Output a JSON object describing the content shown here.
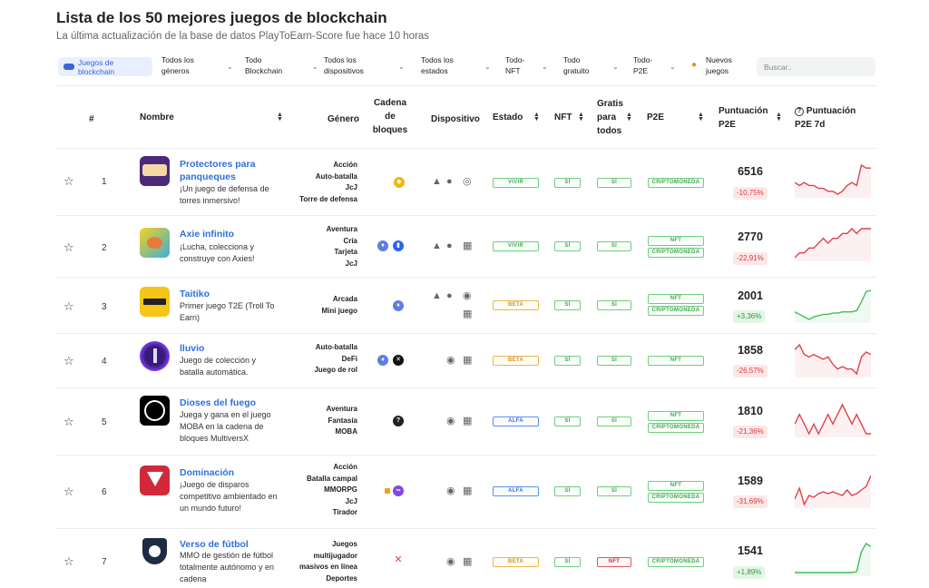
{
  "header": {
    "title": "Lista de los 50 mejores juegos de blockchain",
    "subtitle": "La última actualización de la base de datos PlayToEarn-Score fue hace 10 horas"
  },
  "filters": {
    "active_chip": [
      "Juegos de",
      "blockchain"
    ],
    "genres": [
      "Todos los",
      "géneros"
    ],
    "blockchain": [
      "Todo",
      "Blockchain"
    ],
    "devices": [
      "Todos los",
      "dispositivos"
    ],
    "states": [
      "Todos los",
      "estados"
    ],
    "nft": [
      "Todo-",
      "NFT"
    ],
    "free": [
      "Todo",
      "gratuito"
    ],
    "p2e": [
      "Todo-",
      "P2E"
    ],
    "new_games": [
      "Nuevos",
      "juegos"
    ],
    "search_placeholder": "Buscar.."
  },
  "columns": {
    "rank": "#",
    "name": "Nombre",
    "genre": "Género",
    "chain": [
      "Cadena",
      "de",
      "bloques"
    ],
    "device": "Dispositivo",
    "state": "Estado",
    "nft": "NFT",
    "free": [
      "Gratis",
      "para",
      "todos"
    ],
    "p2e": "P2E",
    "score": [
      "Puntuación",
      "P2E"
    ],
    "score7d": [
      "Puntuación",
      "P2E 7d"
    ]
  },
  "rows": [
    {
      "rank": "1",
      "name": "Protectores para panqueques",
      "desc": "¡Un juego de defensa de torres inmersivo!",
      "genres": [
        "Acción",
        "Auto-batalla",
        "JcJ",
        "Torre de defensa"
      ],
      "state": "VIVIR",
      "state_color": "green",
      "nft": "SÍ",
      "free": "SÍ",
      "p2e": [
        "CRIPTOMONEDA"
      ],
      "p2e_colors": [
        "green"
      ],
      "score": "6516",
      "change": "-10,75%",
      "trend": "down",
      "spark": [
        14,
        13,
        14,
        13,
        13,
        12,
        12,
        11,
        11,
        10,
        11,
        13,
        14,
        13,
        20,
        19,
        19
      ]
    },
    {
      "rank": "2",
      "name": "Axie infinito",
      "desc": "¡Lucha, colecciona y construye con Axies!",
      "genres": [
        "Aventura",
        "Cría",
        "Tarjeta",
        "JcJ"
      ],
      "state": "VIVIR",
      "state_color": "green",
      "nft": "SÍ",
      "free": "SÍ",
      "p2e": [
        "NFT",
        "CRIPTOMONEDA"
      ],
      "p2e_colors": [
        "green",
        "green"
      ],
      "score": "2770",
      "change": "-22,91%",
      "trend": "down",
      "spark": [
        14,
        15,
        15,
        16,
        16,
        17,
        18,
        17,
        18,
        18,
        19,
        19,
        20,
        19,
        20,
        20,
        20
      ]
    },
    {
      "rank": "3",
      "name": "Taitiko",
      "desc": "Primer juego T2E (Troll To Earn)",
      "genres": [
        "Arcada",
        "Mini juego"
      ],
      "state": "BETA",
      "state_color": "yellow",
      "nft": "SÍ",
      "free": "SÍ",
      "p2e": [
        "NFT",
        "CRIPTOMONEDA"
      ],
      "p2e_colors": [
        "green",
        "green"
      ],
      "score": "2001",
      "change": "+3,36%",
      "trend": "up",
      "spark": [
        12,
        10,
        8,
        6,
        8,
        9,
        10,
        10,
        11,
        11,
        12,
        12,
        12,
        13,
        20,
        28,
        29
      ]
    },
    {
      "rank": "4",
      "name": "lluvio",
      "desc": "Juego de colección y batalla automática.",
      "genres": [
        "Auto-batalla",
        "DeFi",
        "Juego de rol"
      ],
      "state": "BETA",
      "state_color": "yellow",
      "nft": "SÍ",
      "free": "SÍ",
      "p2e": [
        "NFT"
      ],
      "p2e_colors": [
        "green"
      ],
      "score": "1858",
      "change": "-26,57%",
      "trend": "down",
      "spark": [
        20,
        22,
        18,
        17,
        18,
        17,
        16,
        17,
        14,
        12,
        13,
        12,
        12,
        10,
        17,
        19,
        18
      ]
    },
    {
      "rank": "5",
      "name": "Dioses del fuego",
      "desc": "Juega y gana en el juego MOBA en la cadena de bloques MultiversX",
      "genres": [
        "Aventura",
        "Fantasía",
        "MOBA"
      ],
      "state": "ALFA",
      "state_color": "blue",
      "nft": "SÍ",
      "free": "SÍ",
      "p2e": [
        "NFT",
        "CRIPTOMONEDA"
      ],
      "p2e_colors": [
        "green",
        "green"
      ],
      "score": "1810",
      "change": "-21,36%",
      "trend": "down",
      "spark": [
        16,
        17,
        16,
        15,
        16,
        15,
        16,
        17,
        16,
        17,
        18,
        17,
        16,
        17,
        16,
        15,
        15
      ]
    },
    {
      "rank": "6",
      "name": "Dominación",
      "desc": "¡Juego de disparos competitivo ambientado en un mundo futuro!",
      "genres": [
        "Acción",
        "Batalla campal",
        "MMORPG",
        "JcJ",
        "Tirador"
      ],
      "state": "ALFA",
      "state_color": "blue",
      "nft": "SÍ",
      "free": "SÍ",
      "p2e": [
        "NFT",
        "CRIPTOMONEDA"
      ],
      "p2e_colors": [
        "green",
        "green"
      ],
      "score": "1589",
      "change": "-31,69%",
      "trend": "down",
      "spark": [
        15,
        21,
        12,
        17,
        16,
        18,
        19,
        18,
        19,
        18,
        17,
        20,
        17,
        18,
        20,
        22,
        28
      ]
    },
    {
      "rank": "7",
      "name": "Verso de fútbol",
      "desc": "MMO de gestión de fútbol totalmente autónomo y en cadena",
      "genres": [
        "Juegos",
        "multijugador",
        "masivos en línea",
        "Deportes"
      ],
      "state": "BETA",
      "state_color": "yellow",
      "nft": "SÍ",
      "free": "NFT",
      "free_color": "red",
      "p2e": [
        "CRIPTOMONEDA"
      ],
      "p2e_colors": [
        "green"
      ],
      "score": "1541",
      "change": "+1,89%",
      "trend": "up",
      "spark": [
        4,
        4,
        4,
        4,
        4,
        4,
        4,
        4,
        4,
        4,
        4,
        4,
        4,
        5,
        25,
        33,
        30
      ]
    }
  ],
  "icons": {
    "star": "star-outline-icon",
    "android": "android-icon",
    "apple": "apple-icon",
    "web": "globe-icon",
    "windows": "windows-icon",
    "steam": "steam-icon"
  },
  "colors": {
    "link": "#2f6fde",
    "down": "#e0424a",
    "up": "#3fbf55"
  }
}
